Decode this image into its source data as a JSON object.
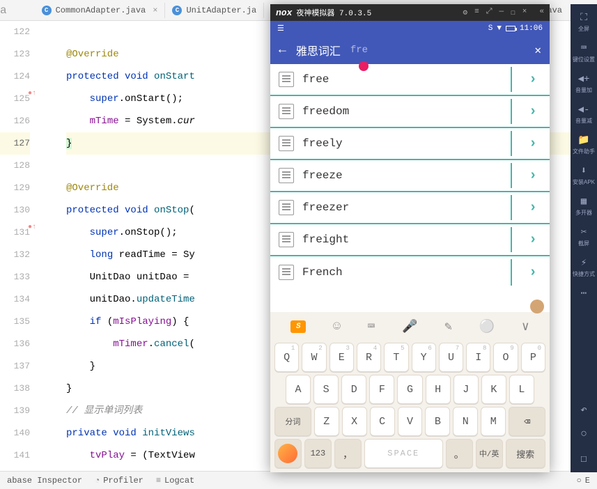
{
  "tabs": {
    "left_ext": "a",
    "items": [
      {
        "name": "CommonAdapter.java"
      },
      {
        "name": "UnitAdapter.ja"
      }
    ],
    "right_ext": ".java"
  },
  "code": {
    "lines": [
      {
        "n": "122",
        "t": ""
      },
      {
        "n": "123",
        "t": "@Override",
        "cls": "ann"
      },
      {
        "n": "124",
        "t": "protected void onStart",
        "kw": "protected",
        "kw2": "void",
        "fn": "onStart"
      },
      {
        "n": "125",
        "t": "    super.onStart();",
        "kw": "super",
        "fn": "onStart"
      },
      {
        "n": "126",
        "t": "    mTime = System.cur",
        "field": "mTime",
        "cls2": "System"
      },
      {
        "n": "127",
        "t": "}",
        "highlight": true
      },
      {
        "n": "128",
        "t": ""
      },
      {
        "n": "129",
        "t": "@Override",
        "cls": "ann"
      },
      {
        "n": "130",
        "t": "protected void onStop(",
        "kw": "protected",
        "kw2": "void",
        "fn": "onStop"
      },
      {
        "n": "131",
        "t": "    super.onStop();",
        "kw": "super",
        "fn": "onStop"
      },
      {
        "n": "132",
        "t": "    long readTime = Sy",
        "kw": "long"
      },
      {
        "n": "133",
        "t": "    UnitDao unitDao = "
      },
      {
        "n": "134",
        "t": "    unitDao.updateTime",
        "fn": "updateTime"
      },
      {
        "n": "135",
        "t": "    if (mIsPlaying) {",
        "kw": "if",
        "field": "mIsPlaying"
      },
      {
        "n": "136",
        "t": "        mTimer.cancel(",
        "field": "mTimer",
        "fn": "cancel"
      },
      {
        "n": "137",
        "t": "    }"
      },
      {
        "n": "138",
        "t": "}"
      },
      {
        "n": "139",
        "t": "// 显示单词列表",
        "cls": "comment"
      },
      {
        "n": "140",
        "t": "private void initViews",
        "kw": "private",
        "kw2": "void",
        "fn": "initViews"
      },
      {
        "n": "141",
        "t": "    tvPlay = (TextView",
        "field": "tvPlay"
      }
    ]
  },
  "emulator": {
    "title": "夜神模拟器 7.0.3.5",
    "status_time": "11:06",
    "app_title": "雅思词汇",
    "search_value": "fre",
    "list": [
      "free",
      "freedom",
      "freely",
      "freeze",
      "freezer",
      "freight",
      "French"
    ]
  },
  "keyboard": {
    "row1": [
      {
        "k": "Q",
        "n": "1"
      },
      {
        "k": "W",
        "n": "2"
      },
      {
        "k": "E",
        "n": "3"
      },
      {
        "k": "R",
        "n": "4"
      },
      {
        "k": "T",
        "n": "5"
      },
      {
        "k": "Y",
        "n": "6"
      },
      {
        "k": "U",
        "n": "7"
      },
      {
        "k": "I",
        "n": "8"
      },
      {
        "k": "O",
        "n": "9"
      },
      {
        "k": "P",
        "n": "0"
      }
    ],
    "row2": [
      "A",
      "S",
      "D",
      "F",
      "G",
      "H",
      "J",
      "K",
      "L"
    ],
    "row3_shift": "分词",
    "row3": [
      "Z",
      "X",
      "C",
      "V",
      "B",
      "N",
      "M"
    ],
    "num_key": "123",
    "space_label": "SPACE",
    "lang_key": "中/英",
    "search_key": "搜索"
  },
  "sidebar": {
    "items": [
      {
        "icon": "⛶",
        "label": "全屏"
      },
      {
        "icon": "⌨",
        "label": "键位设置"
      },
      {
        "icon": "🔊+",
        "label": "音量加"
      },
      {
        "icon": "🔊-",
        "label": "音量减"
      },
      {
        "icon": "📁",
        "label": "文件助手"
      },
      {
        "icon": "⬇",
        "label": "安装APK"
      },
      {
        "icon": "▦",
        "label": "多开器"
      },
      {
        "icon": "✂",
        "label": "截屏"
      },
      {
        "icon": "⚡",
        "label": "快捷方式"
      },
      {
        "icon": "⋯",
        "label": ""
      }
    ]
  },
  "bottom": {
    "inspector": "abase Inspector",
    "profiler": "Profiler",
    "logcat": "Logcat",
    "right": "E"
  }
}
